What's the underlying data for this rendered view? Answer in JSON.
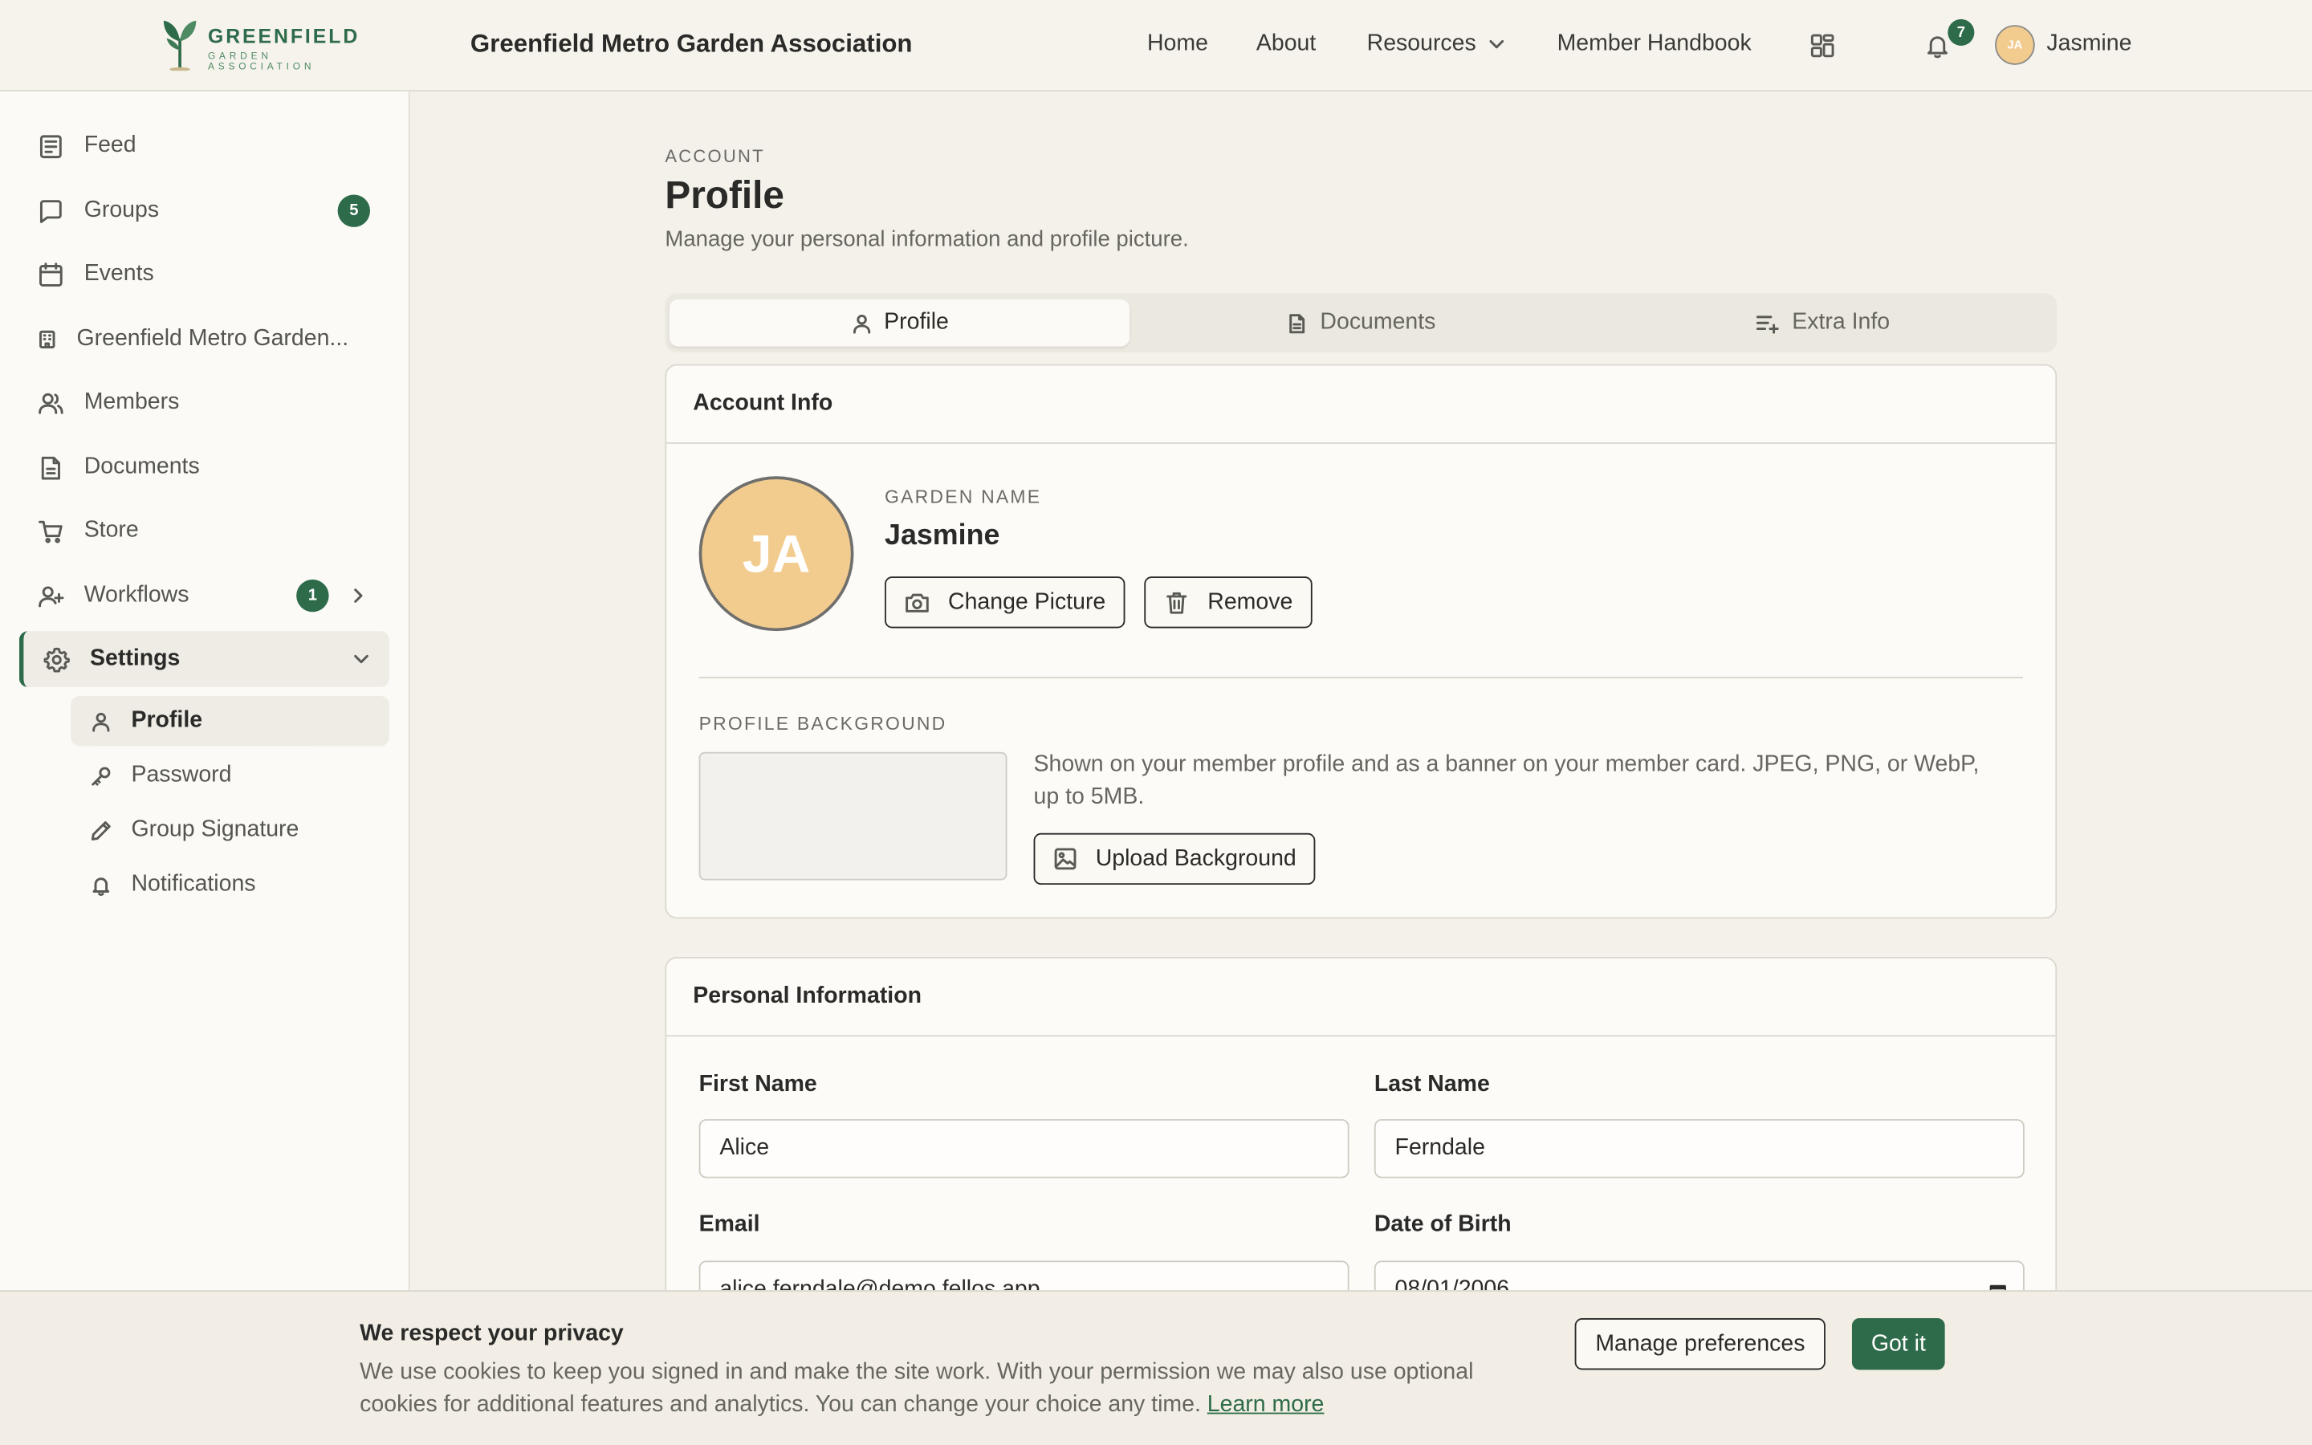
{
  "brand": {
    "logo_word": "GREENFIELD",
    "logo_sub": "GARDEN ASSOCIATION",
    "org_title": "Greenfield Metro Garden Association",
    "accent": "#2e6b4a"
  },
  "topnav": {
    "items": [
      "Home",
      "About",
      "Resources",
      "Member Handbook"
    ],
    "notification_count": "7",
    "user_initials": "JA",
    "user_name": "Jasmine"
  },
  "sidebar": {
    "items": [
      {
        "label": "Feed",
        "icon": "newspaper-icon"
      },
      {
        "label": "Groups",
        "icon": "chat-icon",
        "badge": "5"
      },
      {
        "label": "Events",
        "icon": "calendar-icon"
      },
      {
        "label": "Greenfield Metro Garden...",
        "icon": "building-icon"
      },
      {
        "label": "Members",
        "icon": "users-icon"
      },
      {
        "label": "Documents",
        "icon": "document-icon"
      },
      {
        "label": "Store",
        "icon": "cart-icon"
      },
      {
        "label": "Workflows",
        "icon": "user-plus-icon",
        "badge": "1"
      },
      {
        "label": "Settings",
        "icon": "gear-icon"
      }
    ],
    "settings_sub": [
      {
        "label": "Profile",
        "icon": "user-icon"
      },
      {
        "label": "Password",
        "icon": "key-icon"
      },
      {
        "label": "Group Signature",
        "icon": "pen-icon"
      },
      {
        "label": "Notifications",
        "icon": "bell-icon"
      }
    ]
  },
  "page": {
    "eyebrow": "ACCOUNT",
    "title": "Profile",
    "subtitle": "Manage your personal information and profile picture."
  },
  "tabs": [
    "Profile",
    "Documents",
    "Extra Info"
  ],
  "account_info": {
    "heading": "Account Info",
    "avatar_initials": "JA",
    "garden_name_label": "GARDEN NAME",
    "garden_name": "Jasmine",
    "change_picture": "Change Picture",
    "remove": "Remove",
    "background_label": "PROFILE BACKGROUND",
    "background_desc": "Shown on your member profile and as a banner on your member card. JPEG, PNG, or WebP, up to 5MB.",
    "upload_background": "Upload Background"
  },
  "personal_info": {
    "heading": "Personal Information",
    "first_name_label": "First Name",
    "first_name": "Alice",
    "last_name_label": "Last Name",
    "last_name": "Ferndale",
    "email_label": "Email",
    "email": "alice.ferndale@demo.fellos.app",
    "dob_label": "Date of Birth",
    "dob": "08/01/2006"
  },
  "cookie": {
    "title": "We respect your privacy",
    "text": "We use cookies to keep you signed in and make the site work. With your permission we may also use optional cookies for additional features and analytics. You can change your choice any time.",
    "learn_more": "Learn more",
    "manage": "Manage preferences",
    "accept": "Got it"
  }
}
